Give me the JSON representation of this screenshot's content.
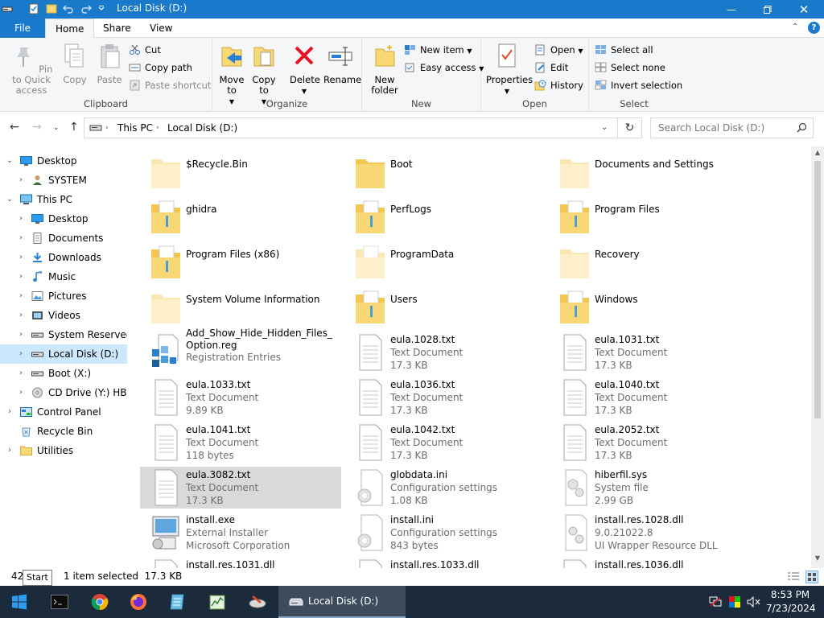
{
  "window": {
    "title": "Local Disk (D:)"
  },
  "ribbon_tabs": [
    "File",
    "Home",
    "Share",
    "View"
  ],
  "ribbon": {
    "clipboard": {
      "label": "Clipboard",
      "pin": "Pin to Quick access",
      "copy": "Copy",
      "paste": "Paste",
      "cut": "Cut",
      "copy_path": "Copy path",
      "paste_shortcut": "Paste shortcut"
    },
    "organize": {
      "label": "Organize",
      "move_to": "Move to",
      "copy_to": "Copy to",
      "delete": "Delete",
      "rename": "Rename"
    },
    "new": {
      "label": "New",
      "new_folder": "New folder",
      "new_item": "New item",
      "easy_access": "Easy access"
    },
    "open": {
      "label": "Open",
      "properties": "Properties",
      "open": "Open",
      "edit": "Edit",
      "history": "History"
    },
    "select": {
      "label": "Select",
      "select_all": "Select all",
      "select_none": "Select none",
      "invert": "Invert selection"
    }
  },
  "address": {
    "crumbs": [
      "This PC",
      "Local Disk (D:)"
    ],
    "search_placeholder": "Search Local Disk (D:)"
  },
  "nav_tree": [
    {
      "label": "Desktop",
      "icon": "desktop",
      "chev": "down"
    },
    {
      "label": "SYSTEM",
      "icon": "user",
      "chev": "right"
    },
    {
      "label": "This PC",
      "icon": "pc",
      "chev": "down"
    },
    {
      "label": "Desktop",
      "icon": "desktop",
      "chev": "right"
    },
    {
      "label": "Documents",
      "icon": "documents",
      "chev": "right"
    },
    {
      "label": "Downloads",
      "icon": "downloads",
      "chev": "right"
    },
    {
      "label": "Music",
      "icon": "music",
      "chev": "right"
    },
    {
      "label": "Pictures",
      "icon": "pictures",
      "chev": "right"
    },
    {
      "label": "Videos",
      "icon": "videos",
      "chev": "right"
    },
    {
      "label": "System Reserved (",
      "icon": "drive",
      "chev": "right"
    },
    {
      "label": "Local Disk (D:)",
      "icon": "drive",
      "chev": "right",
      "selected": true
    },
    {
      "label": "Boot (X:)",
      "icon": "drive",
      "chev": "right"
    },
    {
      "label": "CD Drive (Y:) HBC",
      "icon": "cd",
      "chev": "right"
    },
    {
      "label": "Control Panel",
      "icon": "control",
      "chev": "right"
    },
    {
      "label": "Recycle Bin",
      "icon": "recycle",
      "chev": "none"
    },
    {
      "label": "Utilities",
      "icon": "folder",
      "chev": "right"
    }
  ],
  "files": [
    {
      "name": "$Recycle.Bin",
      "icon": "folder-faded"
    },
    {
      "name": "Boot",
      "icon": "folder"
    },
    {
      "name": "Documents and Settings",
      "icon": "folder-faded"
    },
    {
      "name": "ghidra",
      "icon": "folder-doc"
    },
    {
      "name": "PerfLogs",
      "icon": "folder-doc"
    },
    {
      "name": "Program Files",
      "icon": "folder-doc"
    },
    {
      "name": "Program Files (x86)",
      "icon": "folder-doc"
    },
    {
      "name": "ProgramData",
      "icon": "folder-faded-doc"
    },
    {
      "name": "Recovery",
      "icon": "folder-faded"
    },
    {
      "name": "System Volume Information",
      "icon": "folder-faded"
    },
    {
      "name": "Users",
      "icon": "folder-doc"
    },
    {
      "name": "Windows",
      "icon": "folder-doc"
    },
    {
      "name": "Add_Show_Hide_Hidden_Files_Option.reg",
      "type": "Registration Entries",
      "icon": "reg"
    },
    {
      "name": "eula.1028.txt",
      "type": "Text Document",
      "size": "17.3 KB",
      "icon": "txt"
    },
    {
      "name": "eula.1031.txt",
      "type": "Text Document",
      "size": "17.3 KB",
      "icon": "txt"
    },
    {
      "name": "eula.1033.txt",
      "type": "Text Document",
      "size": "9.89 KB",
      "icon": "txt"
    },
    {
      "name": "eula.1036.txt",
      "type": "Text Document",
      "size": "17.3 KB",
      "icon": "txt"
    },
    {
      "name": "eula.1040.txt",
      "type": "Text Document",
      "size": "17.3 KB",
      "icon": "txt"
    },
    {
      "name": "eula.1041.txt",
      "type": "Text Document",
      "size": "118 bytes",
      "icon": "txt"
    },
    {
      "name": "eula.1042.txt",
      "type": "Text Document",
      "size": "17.3 KB",
      "icon": "txt"
    },
    {
      "name": "eula.2052.txt",
      "type": "Text Document",
      "size": "17.3 KB",
      "icon": "txt"
    },
    {
      "name": "eula.3082.txt",
      "type": "Text Document",
      "size": "17.3 KB",
      "icon": "txt",
      "selected": true
    },
    {
      "name": "globdata.ini",
      "type": "Configuration settings",
      "size": "1.08 KB",
      "icon": "ini"
    },
    {
      "name": "hiberfil.sys",
      "type": "System file",
      "size": "2.99 GB",
      "icon": "sys"
    },
    {
      "name": "install.exe",
      "type": "External Installer",
      "size": "Microsoft Corporation",
      "icon": "exe"
    },
    {
      "name": "install.ini",
      "type": "Configuration settings",
      "size": "843 bytes",
      "icon": "ini"
    },
    {
      "name": "install.res.1028.dll",
      "type": "9.0.21022.8",
      "size": "UI Wrapper Resource DLL",
      "icon": "dll"
    },
    {
      "name": "install.res.1031.dll",
      "icon": "txt"
    },
    {
      "name": "install.res.1033.dll",
      "icon": "txt"
    },
    {
      "name": "install.res.1036.dll",
      "icon": "txt"
    }
  ],
  "status": {
    "count": "42",
    "selection": "1 item selected  17.3 KB"
  },
  "tooltip": "Start",
  "taskbar": {
    "window_label": "Local Disk (D:)",
    "time": "8:53 PM",
    "date": "7/23/2024"
  },
  "colors": {
    "titlebar": "#1979ca",
    "selection": "#cce8ff",
    "taskbar": "#1b2b3c",
    "folder": "#f8d775"
  }
}
